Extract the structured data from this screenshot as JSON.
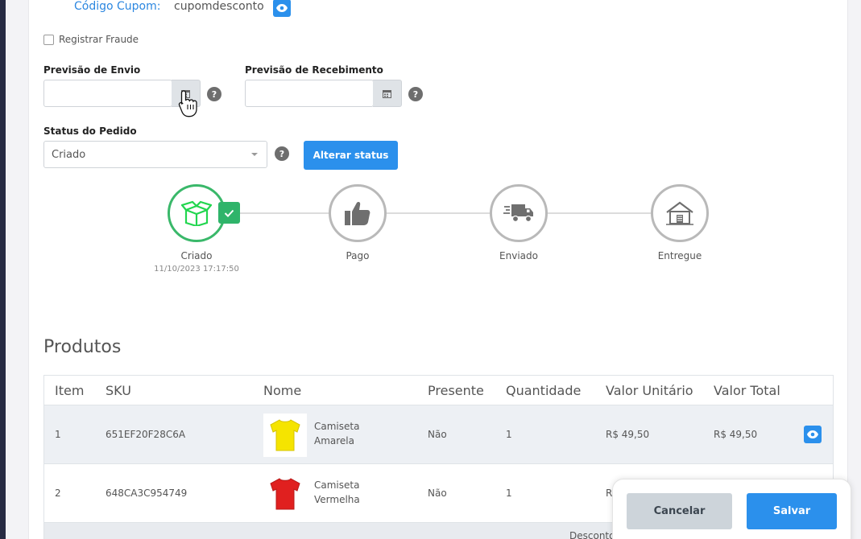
{
  "coupon": {
    "label": "Código Cupom:",
    "value": "cupomdesconto"
  },
  "fraud": {
    "label": "Registrar Fraude"
  },
  "dates": {
    "send_label": "Previsão de Envio",
    "receive_label": "Previsão de Recebimento",
    "send_value": "",
    "receive_value": ""
  },
  "status": {
    "label": "Status do Pedido",
    "selected": "Criado",
    "change_button": "Alterar status"
  },
  "help_glyph": "?",
  "timeline": [
    {
      "label": "Criado",
      "date": "11/10/2023 17:17:50",
      "icon": "open-box-icon",
      "active": true
    },
    {
      "label": "Pago",
      "date": "",
      "icon": "thumbs-up-icon",
      "active": false
    },
    {
      "label": "Enviado",
      "date": "",
      "icon": "delivery-truck-icon",
      "active": false
    },
    {
      "label": "Entregue",
      "date": "",
      "icon": "house-icon",
      "active": false
    }
  ],
  "products": {
    "title": "Produtos",
    "columns": [
      "Item",
      "SKU",
      "Nome",
      "Presente",
      "Quantidade",
      "Valor Unitário",
      "Valor Total"
    ],
    "rows": [
      {
        "item": "1",
        "sku": "651EF20F28C6A",
        "name_line1": "Camiseta",
        "name_line2": "Amarela",
        "gift": "Não",
        "qty": "1",
        "unit": "R$ 49,50",
        "total": "R$ 49,50",
        "shirt_color": "#f5e400"
      },
      {
        "item": "2",
        "sku": "648CA3C954749",
        "name_line1": "Camiseta",
        "name_line2": "Vermelha",
        "gift": "Não",
        "qty": "1",
        "unit": "R",
        "total": "",
        "shirt_color": "#e0201f"
      }
    ],
    "footer_partial": "Desconto"
  },
  "actions": {
    "cancel": "Cancelar",
    "save": "Salvar"
  },
  "colors": {
    "accent": "#2b90ec",
    "success": "#2fb46a",
    "sidebar": "#272b43"
  }
}
